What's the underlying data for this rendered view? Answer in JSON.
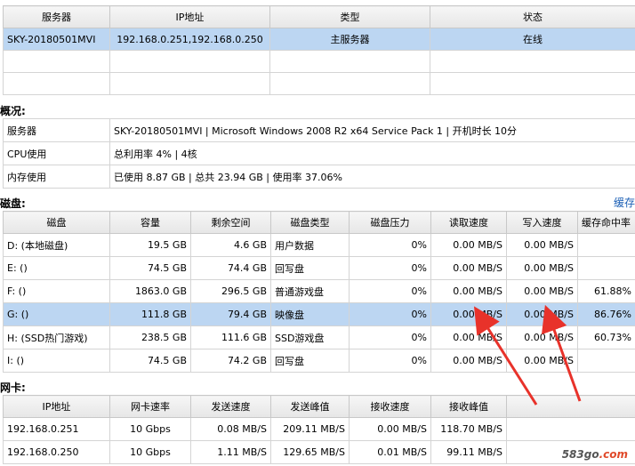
{
  "servers": {
    "headers": [
      "服务器",
      "IP地址",
      "类型",
      "状态"
    ],
    "rows": [
      [
        "SKY-20180501MVI",
        "192.168.0.251,192.168.0.250",
        "主服务器",
        "在线"
      ]
    ]
  },
  "overview": {
    "title": "概况:",
    "rows": [
      [
        "服务器",
        "SKY-20180501MVI | Microsoft Windows 2008 R2 x64 Service Pack 1 | 开机时长 10分"
      ],
      [
        "CPU使用",
        "总利用率 4% | 4核"
      ],
      [
        "内存使用",
        "已使用 8.87 GB | 总共 23.94 GB | 使用率 37.06%"
      ]
    ]
  },
  "disks": {
    "title": "磁盘:",
    "link": "缓存",
    "headers": [
      "磁盘",
      "容量",
      "剩余空间",
      "磁盘类型",
      "磁盘压力",
      "读取速度",
      "写入速度",
      "缓存命中率"
    ],
    "rows": [
      [
        "D: (本地磁盘)",
        "19.5  GB",
        "4.6  GB",
        "用户数据",
        "0%",
        "0.00  MB/S",
        "0.00  MB/S",
        ""
      ],
      [
        "E: ()",
        "74.5  GB",
        "74.4  GB",
        "回写盘",
        "0%",
        "0.00  MB/S",
        "0.00  MB/S",
        ""
      ],
      [
        "F: ()",
        "1863.0  GB",
        "296.5  GB",
        "普通游戏盘",
        "0%",
        "0.00  MB/S",
        "0.00  MB/S",
        "61.88%"
      ],
      [
        "G: ()",
        "111.8  GB",
        "79.4  GB",
        "映像盘",
        "0%",
        "0.00  MB/S",
        "0.00  MB/S",
        "86.76%"
      ],
      [
        "H: (SSD热门游戏)",
        "238.5  GB",
        "111.6  GB",
        "SSD游戏盘",
        "0%",
        "0.00  MB/S",
        "0.00  MB/S",
        "60.73%"
      ],
      [
        "I: ()",
        "74.5  GB",
        "74.2  GB",
        "回写盘",
        "0%",
        "0.00  MB/S",
        "0.00  MB/S",
        ""
      ]
    ]
  },
  "nics": {
    "title": "网卡:",
    "headers": [
      "IP地址",
      "网卡速率",
      "发送速度",
      "发送峰值",
      "接收速度",
      "接收峰值",
      ""
    ],
    "rows": [
      [
        "192.168.0.251",
        "10 Gbps",
        "0.08  MB/S",
        "209.11  MB/S",
        "0.00  MB/S",
        "118.70  MB/S",
        ""
      ],
      [
        "192.168.0.250",
        "10 Gbps",
        "1.11  MB/S",
        "129.65  MB/S",
        "0.01  MB/S",
        "99.11  MB/S",
        ""
      ]
    ]
  },
  "watermark": {
    "brand": "583go",
    "suffix": ".com"
  },
  "colors": {
    "selected_row": "#bcd6f2",
    "arrow": "#e8322a",
    "link": "#1b5fb5"
  }
}
